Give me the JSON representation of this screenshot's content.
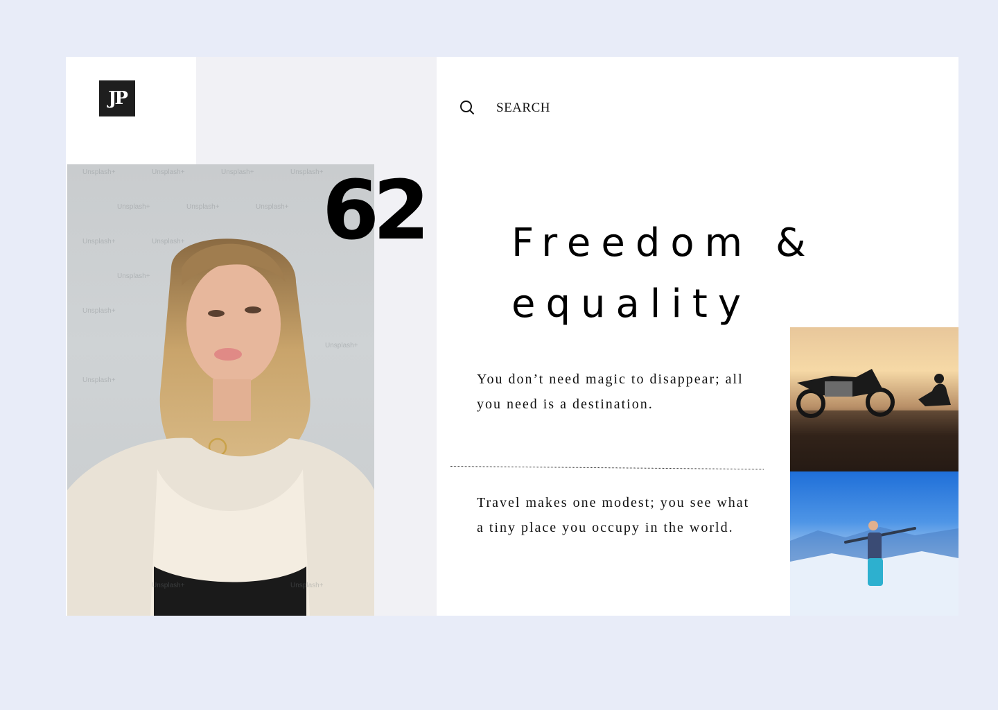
{
  "brand": {
    "logo_text": "JP"
  },
  "search": {
    "label": "SEARCH",
    "icon": "search-icon"
  },
  "feature": {
    "number": "62",
    "headline_line1": "Freedom &",
    "headline_line2": "equality"
  },
  "quotes": [
    "You don’t need magic to disappear; all you need is a destination.",
    "Travel makes one modest; you see what a tiny place you occupy in the world."
  ],
  "images": {
    "portrait": "portrait-photo",
    "moto": "motorcycle-sunset-photo",
    "snow": "snow-mountain-photo"
  },
  "watermark": "Unsplash+",
  "colors": {
    "page_bg": "#e8ecf8",
    "card_bg": "#ffffff",
    "panel_grey": "#f1f1f5",
    "logo_bg": "#1e1e1e",
    "text": "#000000"
  }
}
